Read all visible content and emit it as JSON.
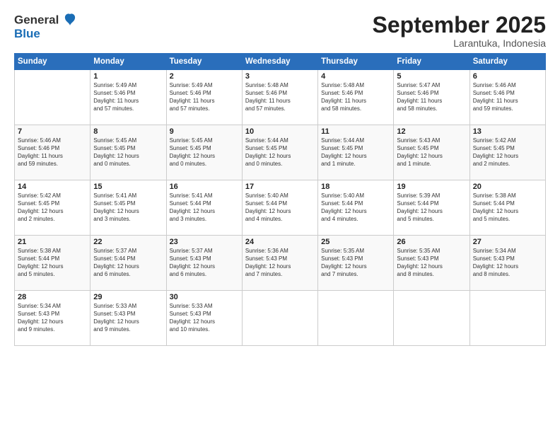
{
  "logo": {
    "line1": "General",
    "line2": "Blue"
  },
  "title": "September 2025",
  "subtitle": "Larantuka, Indonesia",
  "days_header": [
    "Sunday",
    "Monday",
    "Tuesday",
    "Wednesday",
    "Thursday",
    "Friday",
    "Saturday"
  ],
  "weeks": [
    [
      {
        "day": "",
        "info": ""
      },
      {
        "day": "1",
        "info": "Sunrise: 5:49 AM\nSunset: 5:46 PM\nDaylight: 11 hours\nand 57 minutes."
      },
      {
        "day": "2",
        "info": "Sunrise: 5:49 AM\nSunset: 5:46 PM\nDaylight: 11 hours\nand 57 minutes."
      },
      {
        "day": "3",
        "info": "Sunrise: 5:48 AM\nSunset: 5:46 PM\nDaylight: 11 hours\nand 57 minutes."
      },
      {
        "day": "4",
        "info": "Sunrise: 5:48 AM\nSunset: 5:46 PM\nDaylight: 11 hours\nand 58 minutes."
      },
      {
        "day": "5",
        "info": "Sunrise: 5:47 AM\nSunset: 5:46 PM\nDaylight: 11 hours\nand 58 minutes."
      },
      {
        "day": "6",
        "info": "Sunrise: 5:46 AM\nSunset: 5:46 PM\nDaylight: 11 hours\nand 59 minutes."
      }
    ],
    [
      {
        "day": "7",
        "info": "Sunrise: 5:46 AM\nSunset: 5:46 PM\nDaylight: 11 hours\nand 59 minutes."
      },
      {
        "day": "8",
        "info": "Sunrise: 5:45 AM\nSunset: 5:45 PM\nDaylight: 12 hours\nand 0 minutes."
      },
      {
        "day": "9",
        "info": "Sunrise: 5:45 AM\nSunset: 5:45 PM\nDaylight: 12 hours\nand 0 minutes."
      },
      {
        "day": "10",
        "info": "Sunrise: 5:44 AM\nSunset: 5:45 PM\nDaylight: 12 hours\nand 0 minutes."
      },
      {
        "day": "11",
        "info": "Sunrise: 5:44 AM\nSunset: 5:45 PM\nDaylight: 12 hours\nand 1 minute."
      },
      {
        "day": "12",
        "info": "Sunrise: 5:43 AM\nSunset: 5:45 PM\nDaylight: 12 hours\nand 1 minute."
      },
      {
        "day": "13",
        "info": "Sunrise: 5:42 AM\nSunset: 5:45 PM\nDaylight: 12 hours\nand 2 minutes."
      }
    ],
    [
      {
        "day": "14",
        "info": "Sunrise: 5:42 AM\nSunset: 5:45 PM\nDaylight: 12 hours\nand 2 minutes."
      },
      {
        "day": "15",
        "info": "Sunrise: 5:41 AM\nSunset: 5:45 PM\nDaylight: 12 hours\nand 3 minutes."
      },
      {
        "day": "16",
        "info": "Sunrise: 5:41 AM\nSunset: 5:44 PM\nDaylight: 12 hours\nand 3 minutes."
      },
      {
        "day": "17",
        "info": "Sunrise: 5:40 AM\nSunset: 5:44 PM\nDaylight: 12 hours\nand 4 minutes."
      },
      {
        "day": "18",
        "info": "Sunrise: 5:40 AM\nSunset: 5:44 PM\nDaylight: 12 hours\nand 4 minutes."
      },
      {
        "day": "19",
        "info": "Sunrise: 5:39 AM\nSunset: 5:44 PM\nDaylight: 12 hours\nand 5 minutes."
      },
      {
        "day": "20",
        "info": "Sunrise: 5:38 AM\nSunset: 5:44 PM\nDaylight: 12 hours\nand 5 minutes."
      }
    ],
    [
      {
        "day": "21",
        "info": "Sunrise: 5:38 AM\nSunset: 5:44 PM\nDaylight: 12 hours\nand 5 minutes."
      },
      {
        "day": "22",
        "info": "Sunrise: 5:37 AM\nSunset: 5:44 PM\nDaylight: 12 hours\nand 6 minutes."
      },
      {
        "day": "23",
        "info": "Sunrise: 5:37 AM\nSunset: 5:43 PM\nDaylight: 12 hours\nand 6 minutes."
      },
      {
        "day": "24",
        "info": "Sunrise: 5:36 AM\nSunset: 5:43 PM\nDaylight: 12 hours\nand 7 minutes."
      },
      {
        "day": "25",
        "info": "Sunrise: 5:35 AM\nSunset: 5:43 PM\nDaylight: 12 hours\nand 7 minutes."
      },
      {
        "day": "26",
        "info": "Sunrise: 5:35 AM\nSunset: 5:43 PM\nDaylight: 12 hours\nand 8 minutes."
      },
      {
        "day": "27",
        "info": "Sunrise: 5:34 AM\nSunset: 5:43 PM\nDaylight: 12 hours\nand 8 minutes."
      }
    ],
    [
      {
        "day": "28",
        "info": "Sunrise: 5:34 AM\nSunset: 5:43 PM\nDaylight: 12 hours\nand 9 minutes."
      },
      {
        "day": "29",
        "info": "Sunrise: 5:33 AM\nSunset: 5:43 PM\nDaylight: 12 hours\nand 9 minutes."
      },
      {
        "day": "30",
        "info": "Sunrise: 5:33 AM\nSunset: 5:43 PM\nDaylight: 12 hours\nand 10 minutes."
      },
      {
        "day": "",
        "info": ""
      },
      {
        "day": "",
        "info": ""
      },
      {
        "day": "",
        "info": ""
      },
      {
        "day": "",
        "info": ""
      }
    ]
  ]
}
